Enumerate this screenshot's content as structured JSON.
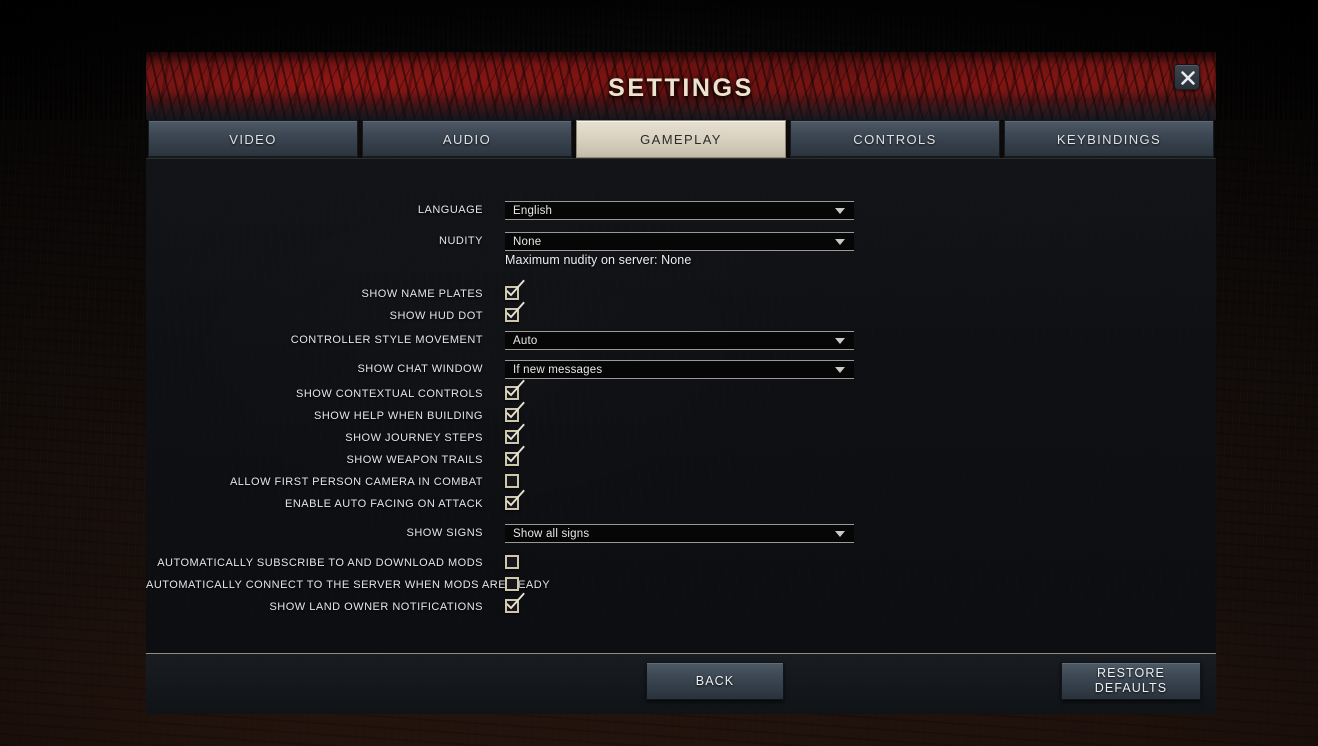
{
  "window": {
    "title": "SETTINGS",
    "close_icon": "close-icon",
    "close_label": "X"
  },
  "tabs": [
    {
      "label": "VIDEO",
      "active": false
    },
    {
      "label": "AUDIO",
      "active": false
    },
    {
      "label": "GAMEPLAY",
      "active": true
    },
    {
      "label": "CONTROLS",
      "active": false
    },
    {
      "label": "KEYBINDINGS",
      "active": false
    }
  ],
  "settings": {
    "language": {
      "label": "LANGUAGE",
      "value": "English"
    },
    "nudity": {
      "label": "NUDITY",
      "value": "None"
    },
    "nudity_note": {
      "text": "Maximum nudity on server: None"
    },
    "show_name_plates": {
      "label": "SHOW NAME PLATES",
      "checked": true
    },
    "show_hud_dot": {
      "label": "SHOW HUD DOT",
      "checked": true
    },
    "controller_style": {
      "label": "CONTROLLER STYLE MOVEMENT",
      "value": "Auto"
    },
    "show_chat_window": {
      "label": "SHOW CHAT WINDOW",
      "value": "If new messages"
    },
    "show_contextual": {
      "label": "SHOW CONTEXTUAL CONTROLS",
      "checked": true
    },
    "show_help_building": {
      "label": "SHOW HELP WHEN BUILDING",
      "checked": true
    },
    "show_journey_steps": {
      "label": "SHOW JOURNEY STEPS",
      "checked": true
    },
    "show_weapon_trails": {
      "label": "SHOW WEAPON TRAILS",
      "checked": true
    },
    "allow_first_person": {
      "label": "ALLOW FIRST PERSON CAMERA IN COMBAT",
      "checked": false
    },
    "enable_auto_facing": {
      "label": "ENABLE AUTO FACING ON ATTACK",
      "checked": true
    },
    "show_signs": {
      "label": "SHOW SIGNS",
      "value": "Show all signs"
    },
    "auto_subscribe": {
      "label": "AUTOMATICALLY SUBSCRIBE TO AND DOWNLOAD MODS",
      "checked": false
    },
    "auto_connect": {
      "label": "AUTOMATICALLY CONNECT TO THE SERVER WHEN MODS ARE READY",
      "checked": false
    },
    "land_owner_notify": {
      "label": "SHOW LAND OWNER NOTIFICATIONS",
      "checked": true
    }
  },
  "footer": {
    "back_label": "BACK",
    "restore_line1": "RESTORE",
    "restore_line2": "DEFAULTS"
  },
  "colors": {
    "header_red": "#6b1a16",
    "active_tab": "#ddd6c6",
    "tab_slate": "#414b57",
    "title_text": "#ece3cf",
    "checkbox_border": "#cfc6ab",
    "panel_bg": "#0e1014"
  }
}
